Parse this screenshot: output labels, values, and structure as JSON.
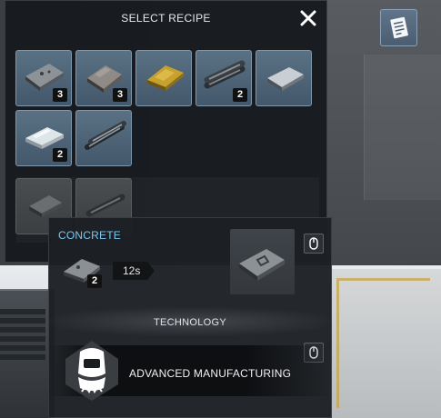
{
  "panel": {
    "title": "SELECT RECIPE",
    "recipes": [
      {
        "icon": "concrete-slab-icon",
        "count": "3"
      },
      {
        "icon": "stone-block-icon",
        "count": "3"
      },
      {
        "icon": "gold-ingot-icon",
        "count": ""
      },
      {
        "icon": "steel-pipes-icon",
        "count": "2"
      },
      {
        "icon": "metal-plate-icon",
        "count": ""
      },
      {
        "icon": "glass-sheet-icon",
        "count": "2"
      },
      {
        "icon": "metal-rods-icon",
        "count": ""
      }
    ],
    "locked_recipes": [
      {
        "icon": "locked-slab-icon"
      },
      {
        "icon": "locked-pipe-icon"
      }
    ]
  },
  "tooltip": {
    "name": "CONCRETE",
    "ingredient_count": "2",
    "time": "12s",
    "technology_heading": "TECHNOLOGY",
    "technology_name": "ADVANCED MANUFACTURING"
  },
  "colors": {
    "accent": "#7cc6f0",
    "slot_active": "#4f6578",
    "slot_disabled": "#43464a"
  }
}
